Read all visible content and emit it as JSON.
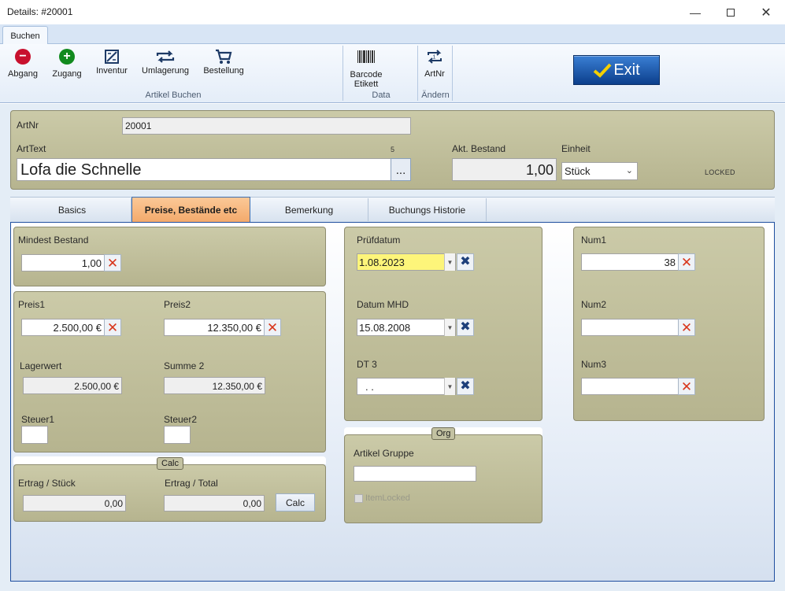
{
  "window": {
    "title": "Details: #20001"
  },
  "ribbon": {
    "tab": "Buchen",
    "buttons": {
      "abgang": "Abgang",
      "zugang": "Zugang",
      "inventur": "Inventur",
      "umlagerung": "Umlagerung",
      "bestellung": "Bestellung",
      "barcode_line1": "Barcode",
      "barcode_line2": "Etikett",
      "artnr": "ArtNr"
    },
    "groups": {
      "artikel_buchen": "Artikel Buchen",
      "data": "Data",
      "aendern": "Ändern"
    },
    "exit_label": "Exit",
    "colors": {
      "abgang_icon": "#c8102e",
      "zugang_icon": "#118a1e"
    }
  },
  "header": {
    "artnr_label": "ArtNr",
    "artnr_value": "20001",
    "arttext_label": "ArtText",
    "arttext_counter": "5",
    "arttext_value": "Lofa die Schnelle",
    "ellipsis": "...",
    "bestand_label": "Akt. Bestand",
    "bestand_value": "1,00",
    "einheit_label": "Einheit",
    "einheit_value": "Stück",
    "locked": "LOCKED"
  },
  "tabs": [
    {
      "label": "Basics"
    },
    {
      "label": "Preise, Bestände etc"
    },
    {
      "label": "Bemerkung"
    },
    {
      "label": "Buchungs Historie"
    }
  ],
  "preise": {
    "mindest_label": "Mindest Bestand",
    "mindest_value": "1,00",
    "preis1_label": "Preis1",
    "preis1_value": "2.500,00 €",
    "preis2_label": "Preis2",
    "preis2_value": "12.350,00 €",
    "lagerwert_label": "Lagerwert",
    "lagerwert_value": "2.500,00 €",
    "summe2_label": "Summe 2",
    "summe2_value": "12.350,00 €",
    "steuer1_label": "Steuer1",
    "steuer2_label": "Steuer2",
    "calc_caption": "Calc",
    "ertrag_stueck_label": "Ertrag / Stück",
    "ertrag_stueck_value": "0,00",
    "ertrag_total_label": "Ertrag / Total",
    "ertrag_total_value": "0,00",
    "calc_button": "Calc"
  },
  "dates": {
    "pruefdatum_label": "Prüfdatum",
    "pruefdatum_value": "1.08.2023",
    "pruefdatum_highlight": "#fdf57a",
    "mhd_label": "Datum MHD",
    "mhd_value": "15.08.2008",
    "dt3_label": "DT 3",
    "dt3_value": ".  ."
  },
  "org": {
    "caption": "Org",
    "gruppe_label": "Artikel Gruppe",
    "gruppe_value": "",
    "itemlocked_label": "ItemLocked"
  },
  "nums": {
    "num1_label": "Num1",
    "num1_value": "38",
    "num2_label": "Num2",
    "num2_value": "",
    "num3_label": "Num3",
    "num3_value": ""
  }
}
